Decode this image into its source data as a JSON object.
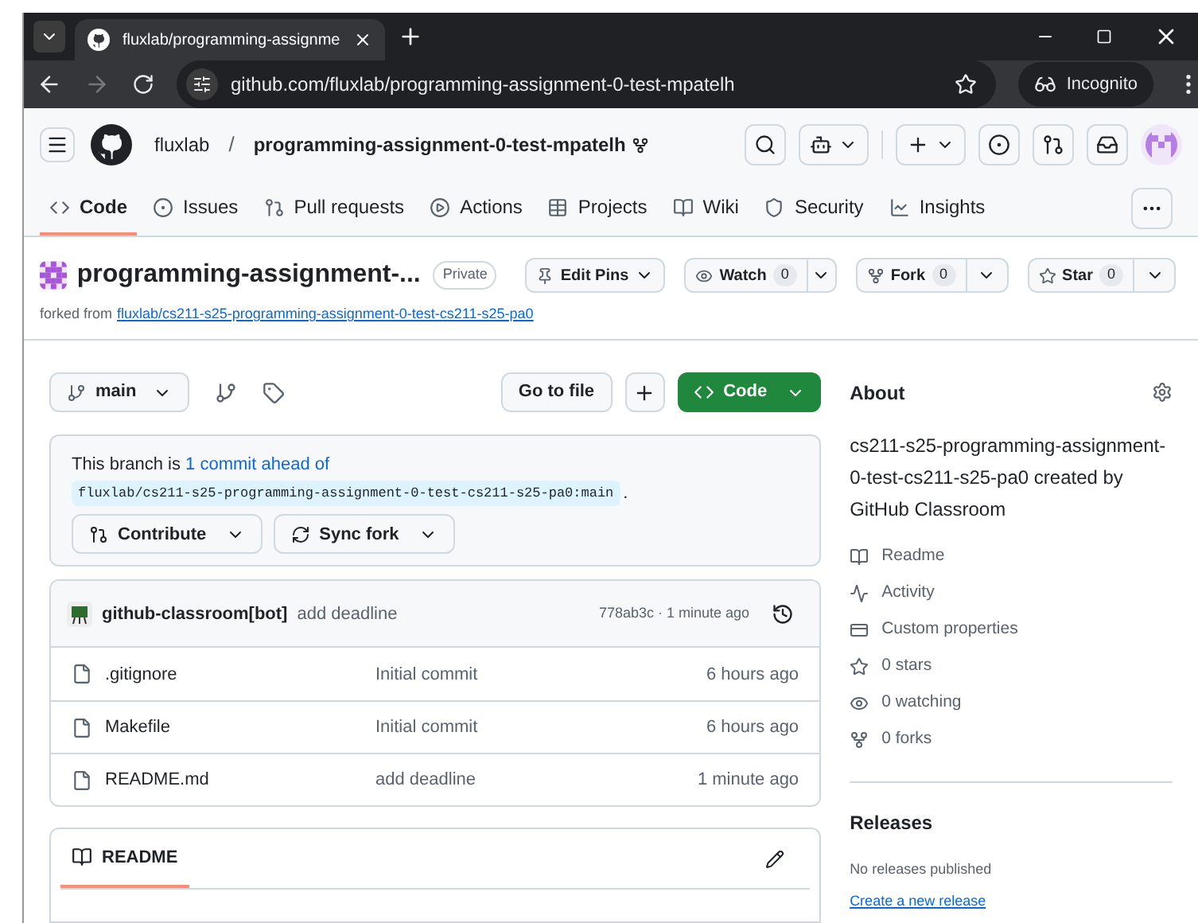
{
  "browser": {
    "tab_title": "fluxlab/programming-assignme",
    "url": "github.com/fluxlab/programming-assignment-0-test-mpatelh",
    "profile": "Incognito"
  },
  "header": {
    "owner": "fluxlab",
    "separator": "/",
    "repo": "programming-assignment-0-test-mpatelh"
  },
  "nav_tabs": [
    {
      "label": "Code",
      "selected": true
    },
    {
      "label": "Issues",
      "selected": false
    },
    {
      "label": "Pull requests",
      "selected": false
    },
    {
      "label": "Actions",
      "selected": false
    },
    {
      "label": "Projects",
      "selected": false
    },
    {
      "label": "Wiki",
      "selected": false
    },
    {
      "label": "Security",
      "selected": false
    },
    {
      "label": "Insights",
      "selected": false
    }
  ],
  "repo": {
    "title": "programming-assignment-...",
    "visibility": "Private",
    "forked_prefix": "forked from",
    "forked_link": "fluxlab/cs211-s25-programming-assignment-0-test-cs211-s25-pa0"
  },
  "repo_actions": [
    {
      "label": "Edit Pins"
    },
    {
      "label": "Watch",
      "count": "0"
    },
    {
      "label": "Fork",
      "count": "0"
    },
    {
      "label": "Star",
      "count": "0"
    }
  ],
  "branch": {
    "name": "main"
  },
  "go_to_file": "Go to file",
  "code_button": "Code",
  "ahead": {
    "text": "This branch is",
    "link": "1 commit ahead of",
    "ref": "fluxlab/cs211-s25-programming-assignment-0-test-cs211-s25-pa0:main",
    "end": "."
  },
  "ahead_buttons": [
    "Contribute",
    "Sync fork"
  ],
  "commit": {
    "author": "github-classroom[bot]",
    "message": "add deadline",
    "meta": "778ab3c · 1 minute ago"
  },
  "files": [
    {
      "name": ".gitignore",
      "message": "Initial commit",
      "time": "6 hours ago"
    },
    {
      "name": "Makefile",
      "message": "Initial commit",
      "time": "6 hours ago"
    },
    {
      "name": "README.md",
      "message": "add deadline",
      "time": "1 minute ago"
    }
  ],
  "readme_tab": "README",
  "about": {
    "title": "About",
    "description": "cs211-s25-programming-assignment-0-test-cs211-s25-pa0 created by GitHub Classroom",
    "links": [
      "Readme",
      "Activity",
      "Custom properties",
      "0 stars",
      "0 watching",
      "0 forks"
    ]
  },
  "releases": {
    "title": "Releases",
    "note": "No releases published",
    "link": "Create a new release"
  }
}
